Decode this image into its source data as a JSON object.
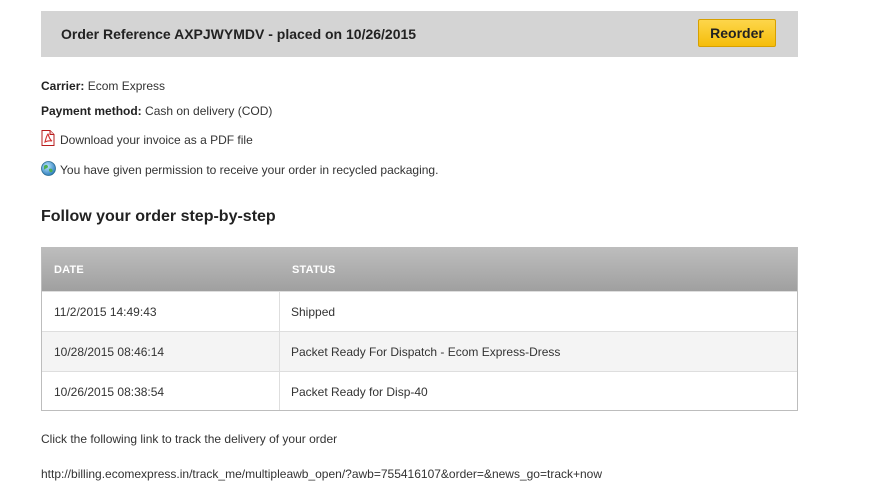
{
  "header": {
    "title": "Order Reference AXPJWYMDV - placed on 10/26/2015",
    "reorder_label": "Reorder"
  },
  "details": {
    "carrier_label": "Carrier:",
    "carrier_value": "Ecom Express",
    "payment_label": "Payment method:",
    "payment_value": "Cash on delivery (COD)",
    "invoice_link": "Download your invoice as a PDF file",
    "recycled_note": "You have given permission to receive your order in recycled packaging.",
    "icons": [
      "pdf-icon",
      "globe-icon"
    ]
  },
  "tracking_section": {
    "title": "Follow your order step-by-step",
    "columns": [
      "DATE",
      "STATUS"
    ],
    "rows": [
      {
        "date": "11/2/2015 14:49:43",
        "status": "Shipped"
      },
      {
        "date": "10/28/2015 08:46:14",
        "status": "Packet Ready For Dispatch - Ecom Express-Dress"
      },
      {
        "date": "10/26/2015 08:38:54",
        "status": "Packet Ready for Disp-40"
      }
    ]
  },
  "delivery": {
    "instruction": "Click the following link to track the delivery of your order",
    "link": "http://billing.ecomexpress.in/track_me/multipleawb_open/?awb=755416107&order=&news_go=track+now"
  },
  "colors": {
    "header_bg": "#d4d4d4",
    "reorder_button": "#f5bd0a",
    "table_header": "#a8a8a8"
  }
}
